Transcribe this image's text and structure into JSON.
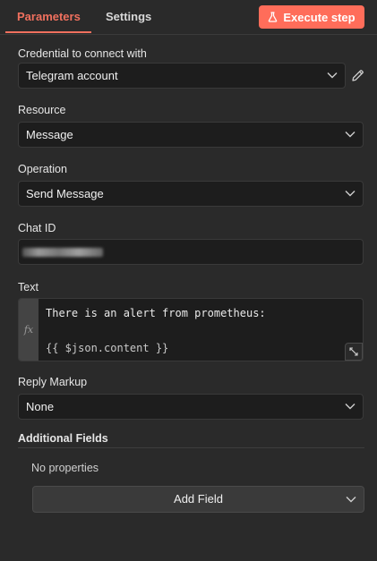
{
  "tabs": {
    "parameters": "Parameters",
    "settings": "Settings"
  },
  "execute_button": {
    "label": "Execute step",
    "icon": "flask-icon",
    "color": "#ff6d5a"
  },
  "fields": {
    "credential": {
      "label": "Credential to connect with",
      "value": "Telegram account"
    },
    "resource": {
      "label": "Resource",
      "value": "Message"
    },
    "operation": {
      "label": "Operation",
      "value": "Send Message"
    },
    "chat_id": {
      "label": "Chat ID"
    },
    "text": {
      "label": "Text",
      "line1": "There is an alert from prometheus:",
      "line2": "{{ $json.content }}"
    },
    "reply_markup": {
      "label": "Reply Markup",
      "value": "None"
    }
  },
  "additional_fields": {
    "title": "Additional Fields",
    "empty_text": "No properties",
    "add_button": "Add Field"
  },
  "colors": {
    "accent": "#f0705e",
    "background": "#2a2a2a",
    "input_bg": "#1d1d1d"
  }
}
